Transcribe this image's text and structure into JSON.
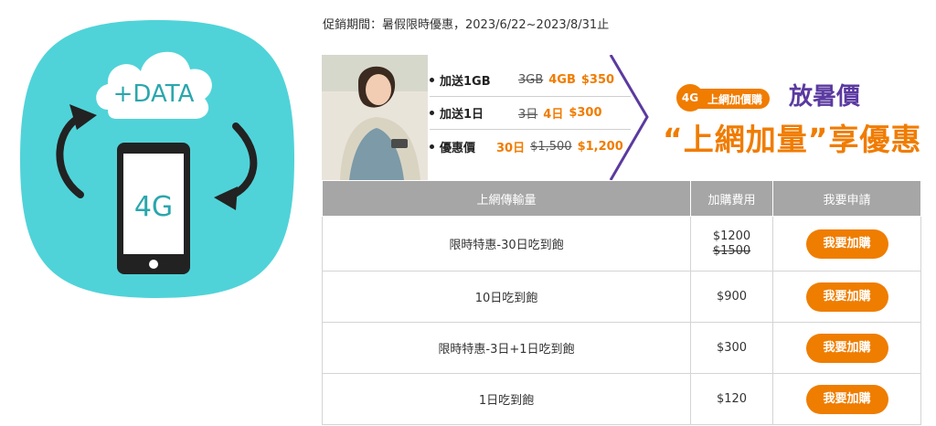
{
  "icon": {
    "cloud_text": "+DATA",
    "phone_text": "4G",
    "colors": {
      "background": "#4fd3d8",
      "ink": "#222222",
      "phone_screen": "#ffffff"
    }
  },
  "promo_period": "促銷期間：暑假限時優惠，2023/6/22~2023/8/31止",
  "banner": {
    "offers": [
      {
        "label": "加送1GB",
        "old": "3GB",
        "days": "4GB",
        "price": "$350"
      },
      {
        "label": "加送1日",
        "old": "3日",
        "days": "4日",
        "price": "$300"
      },
      {
        "label": "優惠價",
        "days": "30日",
        "old": "$1,500",
        "price": "$1,200"
      }
    ],
    "tag_4g": "4G",
    "tag_text": "上網加價購",
    "slogan_top": "放暑價",
    "slogan_bottom": "“上網加量”享優惠",
    "colors": {
      "orange": "#f07c00",
      "purple": "#5b3aa0"
    }
  },
  "table": {
    "headers": [
      "上網傳輸量",
      "加購費用",
      "我要申請"
    ],
    "rows": [
      {
        "plan": "限時特惠-30日吃到飽",
        "price": "$1200",
        "old_price": "$1500",
        "button": "我要加購"
      },
      {
        "plan": "10日吃到飽",
        "price": "$900",
        "button": "我要加購"
      },
      {
        "plan": "限時特惠-3日+1日吃到飽",
        "price": "$300",
        "button": "我要加購"
      },
      {
        "plan": "1日吃到飽",
        "price": "$120",
        "button": "我要加購"
      }
    ]
  }
}
